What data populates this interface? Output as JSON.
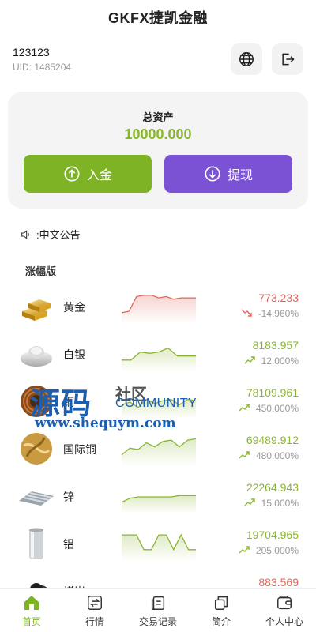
{
  "app": {
    "title": "GKFX捷凯金融"
  },
  "user": {
    "name": "123123",
    "uid_label": "UID:",
    "uid": "1485204"
  },
  "assets": {
    "label": "总资产",
    "value": "10000.000",
    "deposit_label": "入金",
    "withdraw_label": "提现"
  },
  "notice": {
    "text": ":中文公告"
  },
  "section": {
    "title": "涨幅版"
  },
  "colors": {
    "up": "#8ab62f",
    "down": "#e0665a",
    "deposit": "#7db324",
    "withdraw": "#7b52d3"
  },
  "market": [
    {
      "name": "黄金",
      "price": "773.233",
      "change": "-14.960%",
      "direction": "down",
      "icon": "gold-bars-icon",
      "trend": [
        0.3,
        0.35,
        0.9,
        0.95,
        0.95,
        0.85,
        0.9,
        0.8,
        0.85,
        0.85,
        0.85
      ]
    },
    {
      "name": "白银",
      "price": "8183.957",
      "change": "12.000%",
      "direction": "up",
      "icon": "silver-ingot-icon",
      "trend": [
        0.3,
        0.3,
        0.6,
        0.55,
        0.6,
        0.75,
        0.45,
        0.45,
        0.45
      ]
    },
    {
      "name": "铜",
      "price": "78109.961",
      "change": "450.000%",
      "direction": "up",
      "icon": "copper-coil-icon",
      "trend": [
        0.4,
        0.5,
        0.3,
        0.6,
        0.45,
        0.55,
        0.6,
        0.4,
        0.6,
        0.55
      ]
    },
    {
      "name": "国际铜",
      "price": "69489.912",
      "change": "480.000%",
      "direction": "up",
      "icon": "copper-ball-icon",
      "trend": [
        0.3,
        0.55,
        0.5,
        0.75,
        0.6,
        0.8,
        0.85,
        0.6,
        0.85,
        0.9
      ]
    },
    {
      "name": "锌",
      "price": "22264.943",
      "change": "15.000%",
      "direction": "up",
      "icon": "zinc-plates-icon",
      "trend": [
        0.3,
        0.45,
        0.5,
        0.5,
        0.5,
        0.5,
        0.5,
        0.55,
        0.55,
        0.55
      ]
    },
    {
      "name": "铝",
      "price": "19704.965",
      "change": "205.000%",
      "direction": "up",
      "icon": "aluminum-can-icon",
      "trend": [
        0.85,
        0.85,
        0.85,
        0.3,
        0.3,
        0.85,
        0.85,
        0.3,
        0.85,
        0.3,
        0.3
      ]
    },
    {
      "name": "煤炭",
      "price": "883.569",
      "change": "",
      "direction": "down",
      "icon": "coal-icon",
      "trend": [
        0.3,
        0.5
      ]
    }
  ],
  "tabs": [
    {
      "label": "首页",
      "icon": "home-icon",
      "active": true
    },
    {
      "label": "行情",
      "icon": "exchange-icon",
      "active": false
    },
    {
      "label": "交易记录",
      "icon": "records-icon",
      "active": false
    },
    {
      "label": "简介",
      "icon": "copy-icon",
      "active": false
    },
    {
      "label": "个人中心",
      "icon": "wallet-icon",
      "active": false
    }
  ],
  "watermark": {
    "big": "源码",
    "cn2": "社区",
    "comm": "COMMUNITY",
    "url": "www.shequym.com"
  }
}
